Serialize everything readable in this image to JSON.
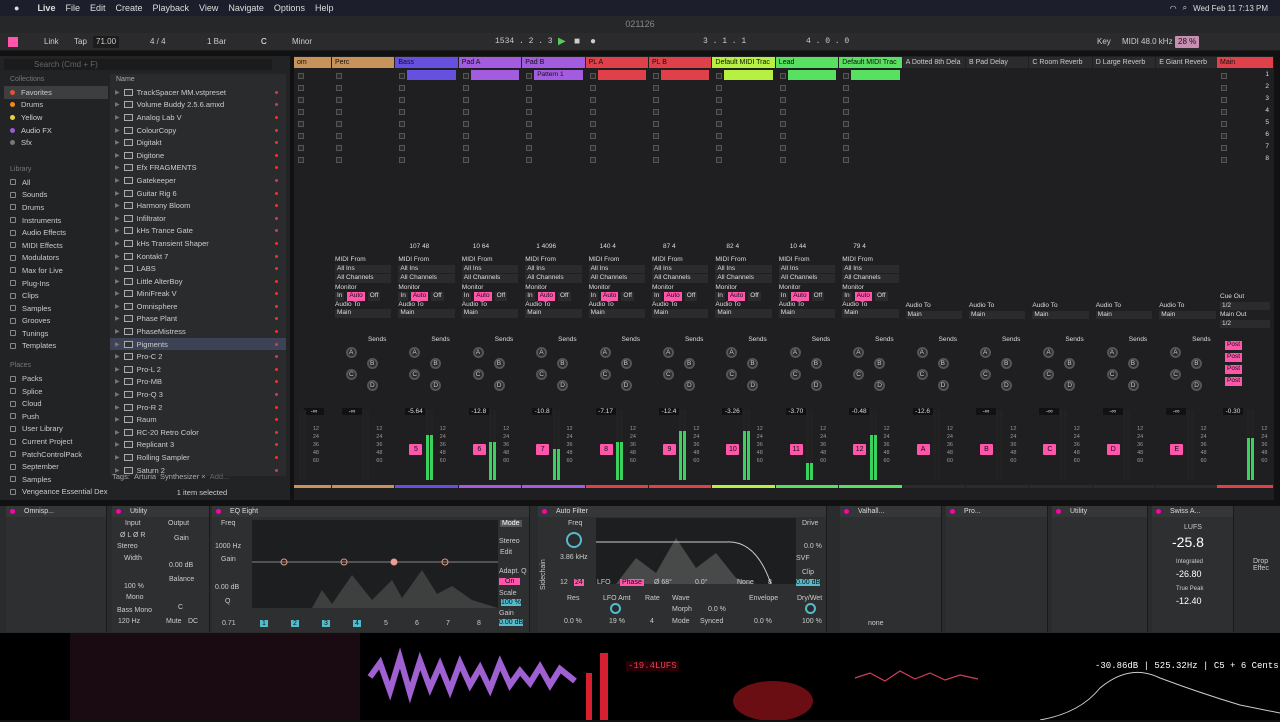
{
  "menubar": {
    "apple": "",
    "app": "Live",
    "items": [
      "File",
      "Edit",
      "Create",
      "Playback",
      "View",
      "Navigate",
      "Options",
      "Help"
    ],
    "datetime": "Wed Feb 11  7:13 PM"
  },
  "title": "021126",
  "control": {
    "link": "Link",
    "tap": "Tap",
    "tempo": "71.00",
    "sig": "4 / 4",
    "quant": "1 Bar",
    "key": "C",
    "scale": "Minor",
    "pos": "1534 .  2 .  3",
    "loop_start": "3 .  1 .  1",
    "loop_len": "4 .  0 .  0",
    "keylbl": "Key",
    "midilbl": "MIDI",
    "sr": "48.0 kHz",
    "cpu": "28 %"
  },
  "browser": {
    "search": "Search (Cmd + F)",
    "collections_hdr": "Collections",
    "collections": [
      {
        "label": "Favorites",
        "color": "#e0533a"
      },
      {
        "label": "Drums",
        "color": "#f08a1f"
      },
      {
        "label": "Yellow",
        "color": "#e8d23a"
      },
      {
        "label": "Audio FX",
        "color": "#9b59d6"
      },
      {
        "label": "Sfx",
        "color": "#777"
      }
    ],
    "library_hdr": "Library",
    "library": [
      "All",
      "Sounds",
      "Drums",
      "Instruments",
      "Audio Effects",
      "MIDI Effects",
      "Modulators",
      "Max for Live",
      "Plug-Ins",
      "Clips",
      "Samples",
      "Grooves",
      "Tunings",
      "Templates"
    ],
    "places_hdr": "Places",
    "places": [
      "Packs",
      "Splice",
      "Cloud",
      "Push",
      "User Library",
      "Current Project",
      "PatchControlPack",
      "September",
      "Samples",
      "Vengeance Essential Dex"
    ],
    "name_hdr": "Name",
    "items": [
      "TrackSpacer MM.vstpreset",
      "Volume Buddy 2.5.6.amxd",
      "Analog Lab V",
      "ColourCopy",
      "Digitakt",
      "Digitone",
      "Efx FRAGMENTS",
      "Gatekeeper",
      "Guitar Rig 6",
      "Harmony Bloom",
      "Infiltrator",
      "kHs Trance Gate",
      "kHs Transient Shaper",
      "Kontakt 7",
      "LABS",
      "Little AlterBoy",
      "MiniFreak V",
      "Omnisphere",
      "Phase Plant",
      "PhaseMistress",
      "Pigments",
      "Pro-C 2",
      "Pro-L 2",
      "Pro-MB",
      "Pro-Q 3",
      "Pro-R 2",
      "Raum",
      "RC-20 Retro Color",
      "Replicant 3",
      "Rolling Sampler",
      "Saturn 2"
    ],
    "selected": "Pigments",
    "tags_lbl": "Tags:",
    "tags": [
      "Arturia",
      "Synthesizer ×",
      "Add..."
    ],
    "selcount": "1 item selected"
  },
  "tracks": [
    {
      "name": "om",
      "color": "#c8935a",
      "num": "",
      "vol": "-∞"
    },
    {
      "name": "Perc",
      "color": "#c8935a",
      "num": "",
      "vol": "-∞",
      "stats": [
        "",
        ""
      ]
    },
    {
      "name": "Bass",
      "color": "#6650e0",
      "num": "5",
      "vol": "-5.64",
      "stats": [
        "107",
        "48"
      ]
    },
    {
      "name": "Pad A",
      "color": "#a35ce0",
      "num": "6",
      "vol": "-12.8",
      "stats": [
        "10",
        "64"
      ]
    },
    {
      "name": "Pad B",
      "color": "#a35ce0",
      "num": "7",
      "vol": "-10.8",
      "stats": [
        "1",
        "4096"
      ],
      "clip": "Pattern 1"
    },
    {
      "name": "PL A",
      "color": "#e0404a",
      "num": "8",
      "vol": "-7.17",
      "stats": [
        "140",
        "4"
      ]
    },
    {
      "name": "PL B",
      "color": "#e0404a",
      "num": "9",
      "vol": "-12.4",
      "stats": [
        "87",
        "4"
      ]
    },
    {
      "name": "Default MIDI Trac",
      "color": "#b6f040",
      "num": "10",
      "vol": "-3.26",
      "stats": [
        "82",
        "4"
      ]
    },
    {
      "name": "Lead",
      "color": "#58e060",
      "num": "11",
      "vol": "-3.70",
      "stats": [
        "10",
        "44"
      ]
    },
    {
      "name": "Default MIDI Trac",
      "color": "#58e060",
      "num": "12",
      "vol": "-0.48",
      "stats": [
        "79",
        "4"
      ]
    },
    {
      "name": "A Dotted 8th Dela",
      "color": "#2b2b2d",
      "num": "A",
      "vol": "-12.6"
    },
    {
      "name": "B Pad Delay",
      "color": "#2b2b2d",
      "num": "B",
      "vol": "-∞"
    },
    {
      "name": "C Room Reverb",
      "color": "#2b2b2d",
      "num": "C",
      "vol": "-∞"
    },
    {
      "name": "D Large Reverb",
      "color": "#2b2b2d",
      "num": "D",
      "vol": "-∞"
    },
    {
      "name": "E Giant Reverb",
      "color": "#2b2b2d",
      "num": "E",
      "vol": "-∞"
    },
    {
      "name": "Main",
      "color": "#e0404a",
      "num": "",
      "vol": "-0.30"
    }
  ],
  "io": {
    "midi_from": "MIDI From",
    "all_ins": "All Ins",
    "all_channels": "All Channels",
    "monitor": "Monitor",
    "in": "In",
    "auto": "Auto",
    "off": "Off",
    "audio_to": "Audio To",
    "main": "Main",
    "sends": "Sends",
    "cue_out": "Cue Out",
    "cue_val": "1/2",
    "main_out": "Main Out",
    "main_val": "1/2",
    "post": "Post",
    "solo": "Solo"
  },
  "scene_nums": [
    "1",
    "2",
    "3",
    "4",
    "5",
    "6",
    "7",
    "8"
  ],
  "send_letters": [
    "A",
    "B",
    "C",
    "D"
  ],
  "meter_scale": [
    "12",
    "24",
    "36",
    "48",
    "60"
  ],
  "devices": {
    "omni": "Omnisp...",
    "utility1": {
      "title": "Utility",
      "input": "Input",
      "output": "Output",
      "phase": "Ø L  Ø R",
      "gain": "Gain",
      "gain_val": "0.00 dB",
      "stereo": "Stereo",
      "width": "Width",
      "width_val": "100 %",
      "balance": "Balance",
      "mono": "Mono",
      "bassmono": "Bass Mono",
      "hz": "120 Hz",
      "mute": "Mute",
      "dc": "DC",
      "c": "C"
    },
    "eq": {
      "title": "EQ Eight",
      "freq": "Freq",
      "freq_val": "1000 Hz",
      "gain": "Gain",
      "gain_val": "0.00 dB",
      "q": "Q",
      "q_val": "0.71",
      "mode": "Mode",
      "mode_val": "Stereo",
      "edit": "Edit",
      "adapt": "Adapt. Q",
      "on": "On",
      "scale": "Scale",
      "scale_val": "100 %",
      "gain2": "Gain",
      "gain2_val": "0.00 dB",
      "db": [
        "12",
        "6",
        "0",
        "-6",
        "-12"
      ],
      "hz": [
        "100",
        "1k",
        "10k"
      ],
      "bands": [
        "1",
        "2",
        "3",
        "4",
        "5",
        "6",
        "7",
        "8"
      ]
    },
    "autofilter": {
      "title": "Auto Filter",
      "freq": "Freq",
      "freq_val": "3.86 kHz",
      "drive": "Drive",
      "drive_val": "0.0 %",
      "svf": "SVF",
      "clip": "Clip",
      "clip_val": "0.00 dB",
      "n12": "12",
      "n24": "24",
      "lfo": "LFO",
      "phase": "Phase",
      "deg1": "Ø 68°",
      "deg2": "0.0°",
      "none": "None",
      "eight": "8",
      "res": "Res",
      "res_val": "0.0 %",
      "lfoamt": "LFO Amt",
      "lfoamt_val": "19 %",
      "rate": "Rate",
      "rate_val": "4",
      "wave": "Wave",
      "morph": "Morph",
      "morph_val": "0.0 %",
      "mode": "Mode",
      "mode_val": "Synced",
      "env": "Envelope",
      "env_val": "0.0 %",
      "drywet": "Dry/Wet",
      "drywet_val": "100 %",
      "sidechain": "Sidechain"
    },
    "valhalla": "Valhall...",
    "proq": "Pro...",
    "utility2": "Utility",
    "swiss": {
      "title": "Swiss A...",
      "lufs": "LUFS",
      "val": "-25.8",
      "integrated": "Integrated",
      "int_val": "-26.80",
      "truepeak": "True Peak",
      "tp_val": "-12.40",
      "drop": "Drop Effec"
    },
    "none": "none"
  },
  "viz": {
    "lufs": "-19.4LUFS",
    "readout": "-30.86dB | 525.32Hz | C5  + 6 Cents"
  },
  "colors": {
    "accent": "#f5a",
    "orange": "#e08a3a"
  }
}
